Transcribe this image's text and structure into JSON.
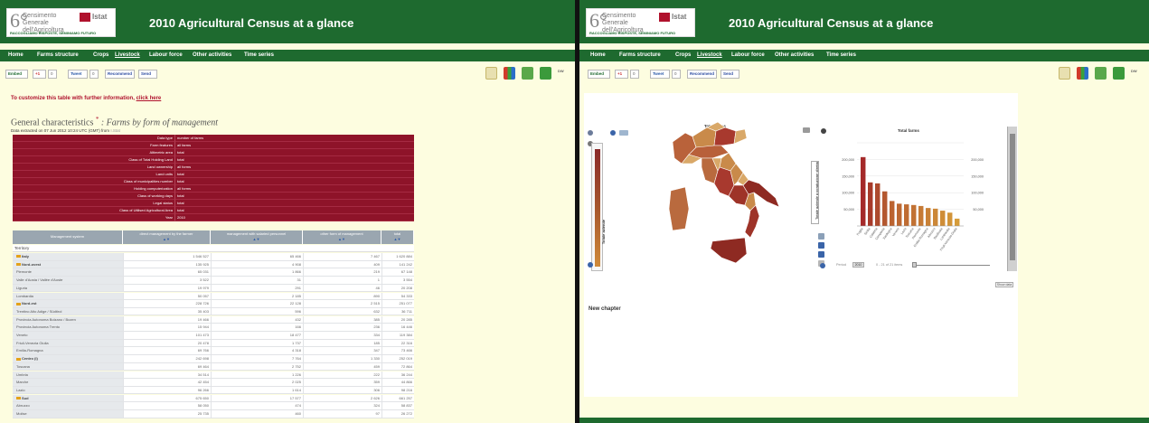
{
  "app": {
    "title": "2010 Agricultural Census at a glance",
    "logo_number": "6°",
    "logo_name": "Censimento Generale dell'Agricoltura",
    "logo_brand": "Istat",
    "logo_tagline": "RACCOGLIAMO RISPOSTE, SEMINIAMO FUTURO"
  },
  "nav": {
    "items": [
      "Home",
      "Farms structure",
      "Crops",
      "Livestock",
      "Labour force",
      "Other activities",
      "Time series"
    ],
    "active": "Livestock"
  },
  "share": {
    "embed": "Embed",
    "gplus": "+1",
    "gplus_count": "0",
    "tweet": "Tweet",
    "tweet_count": "0",
    "recommend": "Recommend",
    "send": "Send"
  },
  "tools": {
    "dw_label": "DW"
  },
  "left": {
    "customize_text": "To customize this table with further information,",
    "customize_link": "click here",
    "title_main": "General characteristics",
    "title_star": "*",
    "title_sub": ": Farms by form of management",
    "extract_text": "Data extracted on 07 Jun 2012 10:24 UTC (GMT) from",
    "extract_link": "I.Stat",
    "filters": [
      {
        "key": "Data type",
        "value": "number of farms"
      },
      {
        "key": "Farm features",
        "value": "all farms"
      },
      {
        "key": "Altimetric area",
        "value": "total"
      },
      {
        "key": "Class of Total Holding Land",
        "value": "total"
      },
      {
        "key": "Land ownership",
        "value": "all forms"
      },
      {
        "key": "Land units",
        "value": "total"
      },
      {
        "key": "Class of municipalities number",
        "value": "total"
      },
      {
        "key": "Holding computerization",
        "value": "all forms"
      },
      {
        "key": "Class of working days",
        "value": "total"
      },
      {
        "key": "Legal status",
        "value": "total"
      },
      {
        "key": "Class of Utilised Agricultural Area",
        "value": "total"
      },
      {
        "key": "Year",
        "value": "2010"
      }
    ],
    "columns": [
      "Management system",
      "direct management by the farmer",
      "management with salaried personnel",
      "other form of management",
      "total"
    ],
    "territory_label": "Territory",
    "rows": [
      {
        "name": "Italy",
        "group": true,
        "v": [
          "1 546 527",
          "65 466",
          "7 467",
          "1 620 884"
        ]
      },
      {
        "name": "Nord-ovest",
        "group": true,
        "v": [
          "135 925",
          "4 908",
          "409",
          "141 242"
        ]
      },
      {
        "name": "Piemonte",
        "group": false,
        "v": [
          "65 031",
          "1 866",
          "219",
          "67 148"
        ]
      },
      {
        "name": "Valle d'Aosta / Vallée d'Aoste",
        "group": false,
        "v": [
          "3 522",
          "31",
          "1",
          "3 554"
        ]
      },
      {
        "name": "Liguria",
        "group": false,
        "v": [
          "19 979",
          "291",
          "46",
          "20 208"
        ]
      },
      {
        "name": "Lombardia",
        "group": false,
        "v": [
          "50 057",
          "2 185",
          "890",
          "54 333"
        ]
      },
      {
        "name": "Nord-est",
        "group": true,
        "v": [
          "228 726",
          "22 128",
          "2 515",
          "251 077"
        ]
      },
      {
        "name": "Trentino Alto Adige / Südtirol",
        "group": false,
        "v": [
          "35 403",
          "596",
          "632",
          "36 711"
        ]
      },
      {
        "name": "Provincia Autonoma Bolzano / Bozen",
        "group": false,
        "v": [
          "19 466",
          "432",
          "385",
          "20 285"
        ]
      },
      {
        "name": "Provincia Autonoma Trento",
        "group": false,
        "v": [
          "15 944",
          "166",
          "236",
          "16 446"
        ]
      },
      {
        "name": "Veneto",
        "group": false,
        "v": [
          "101 473",
          "18 477",
          "334",
          "119 384"
        ]
      },
      {
        "name": "Friuli-Venezia Giulia",
        "group": false,
        "v": [
          "20 478",
          "1 737",
          "185",
          "22 316"
        ]
      },
      {
        "name": "Emilia-Romagna",
        "group": false,
        "v": [
          "69 766",
          "4 318",
          "347",
          "73 466"
        ]
      },
      {
        "name": "Centro (I)",
        "group": true,
        "v": [
          "242 698",
          "7 764",
          "1 330",
          "252 019"
        ]
      },
      {
        "name": "Toscana",
        "group": false,
        "v": [
          "69 464",
          "2 752",
          "459",
          "72 864"
        ]
      },
      {
        "name": "Umbria",
        "group": false,
        "v": [
          "34 514",
          "1 226",
          "222",
          "36 244"
        ]
      },
      {
        "name": "Marche",
        "group": false,
        "v": [
          "42 454",
          "2 025",
          "359",
          "44 866"
        ]
      },
      {
        "name": "Lazio",
        "group": false,
        "v": [
          "96 266",
          "1 614",
          "306",
          "98 216"
        ]
      },
      {
        "name": "Sud",
        "group": true,
        "v": [
          "675 650",
          "17 577",
          "2 626",
          "661 257"
        ]
      },
      {
        "name": "Abruzzo",
        "group": false,
        "v": [
          "58 050",
          "474",
          "324",
          "58 837"
        ]
      },
      {
        "name": "Molise",
        "group": false,
        "v": [
          "25 735",
          "460",
          "97",
          "26 272"
        ]
      }
    ]
  },
  "right": {
    "map_title": "Total farms",
    "map_scale_label": "Totale aziende",
    "bar_vertical_label": "Totale aziende a conduzione diretta",
    "slider_label": "Period",
    "slider_value": "2010",
    "slider_range": "0 - 21 of 21 items",
    "play_label": "Play",
    "show_data_label": "Show data",
    "chapter_label": "New chapter"
  },
  "chart_data": {
    "type": "bar",
    "title": "Total farms",
    "ylim": [
      0,
      250000
    ],
    "yticks": [
      "200,000",
      "150,000",
      "100,000",
      "50,000"
    ],
    "categories": [
      "Puglia",
      "Sicilia",
      "Calabria",
      "Campania",
      "Sardegna",
      "Veneto",
      "Lazio",
      "Toscana",
      "Piemonte",
      "Emilia-Romagna",
      "Abruzzo",
      "Basilicata",
      "Lombardia",
      "Friuli-Venezia Giulia"
    ],
    "values": [
      207000,
      131000,
      128000,
      104000,
      75000,
      67000,
      65000,
      63000,
      60000,
      54000,
      52000,
      46000,
      40000,
      22000
    ],
    "colors": [
      "#a52a2a",
      "#a83a2a",
      "#ad4a2e",
      "#b4572f",
      "#bb6330",
      "#bd6832",
      "#bf6c33",
      "#c27234",
      "#c67a35",
      "#c98136",
      "#cc8737",
      "#cf8d38",
      "#d29439",
      "#d69c3a"
    ]
  }
}
